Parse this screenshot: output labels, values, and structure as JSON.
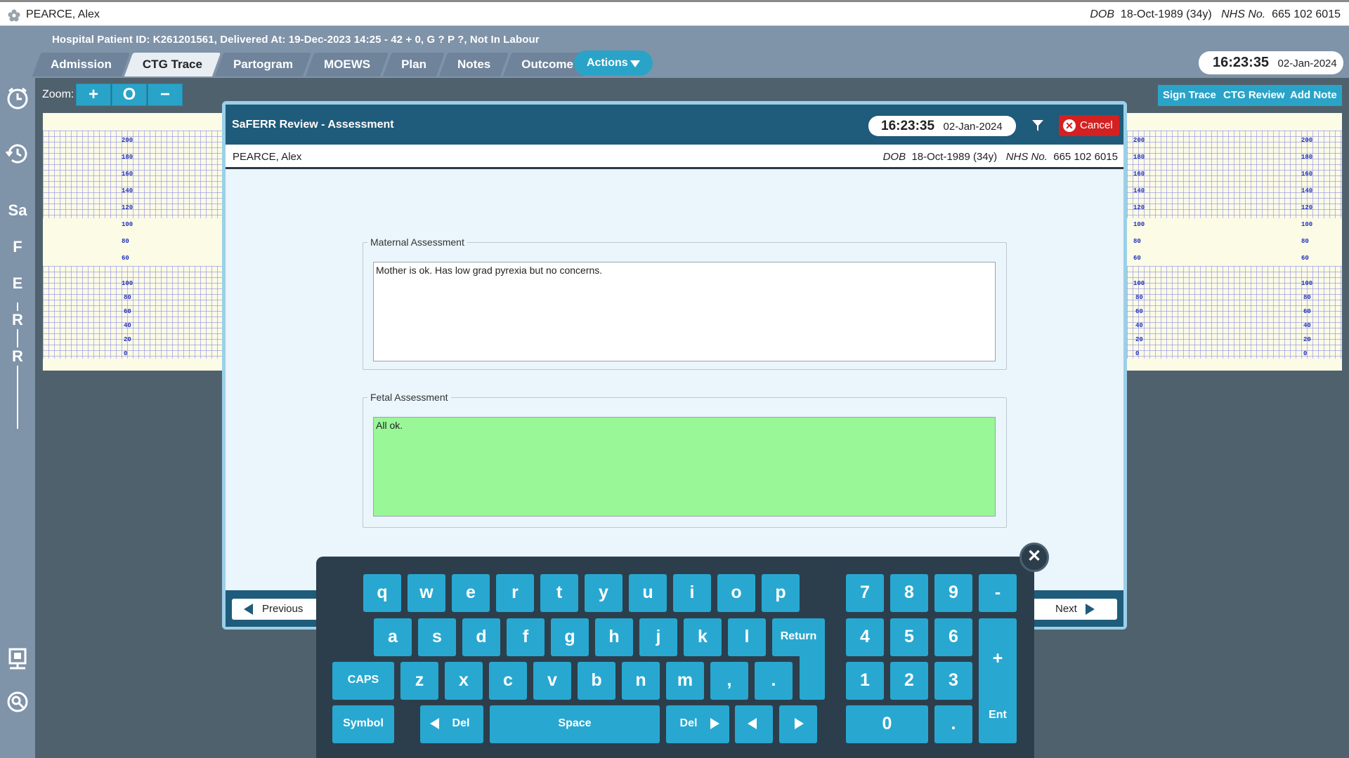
{
  "patient_bar": {
    "name": "PEARCE, Alex",
    "dob_label": "DOB",
    "dob_value": "18-Oct-1989 (34y)",
    "nhs_label": "NHS No.",
    "nhs_value": "665 102 6015"
  },
  "header": {
    "info": "Hospital Patient ID: K261201561, Delivered At: 19-Dec-2023 14:25 - 42 + 0, G ? P ?,   Not In Labour",
    "tabs": [
      {
        "label": "Admission"
      },
      {
        "label": "CTG Trace",
        "active": true
      },
      {
        "label": "Partogram"
      },
      {
        "label": "MOEWS"
      },
      {
        "label": "Plan"
      },
      {
        "label": "Notes"
      },
      {
        "label": "Outcome"
      }
    ],
    "actions_label": "Actions",
    "clock_time": "16:23:35",
    "clock_date": "02-Jan-2024"
  },
  "sidebar": {
    "letters": [
      "Sa",
      "F",
      "E",
      "R",
      "R"
    ]
  },
  "toolbar": {
    "zoom_label": "Zoom:",
    "zoom_in": "+",
    "zoom_reset": "O",
    "zoom_out": "−",
    "sign_trace": "Sign Trace",
    "ctg_review": "CTG Review",
    "add_note": "Add Note"
  },
  "ctg_scale": {
    "fhr": [
      "200",
      "180",
      "160",
      "140",
      "120",
      "100",
      "80",
      "60"
    ],
    "toco": [
      "100",
      "80",
      "60",
      "40",
      "20",
      "0"
    ]
  },
  "modal": {
    "title": "SaFERR Review - Assessment",
    "clock_time": "16:23:35",
    "clock_date": "02-Jan-2024",
    "cancel_label": "Cancel",
    "patient_name": "PEARCE, Alex",
    "dob_label": "DOB",
    "dob_value": "18-Oct-1989 (34y)",
    "nhs_label": "NHS No.",
    "nhs_value": "665 102 6015",
    "maternal_legend": "Maternal Assessment",
    "maternal_text": "Mother is ok. Has low grad pyrexia but no concerns.",
    "fetal_legend": "Fetal Assessment",
    "fetal_text": "All ok.",
    "fetal_bg": "#99f797",
    "previous_label": "Previous",
    "next_label": "Next"
  },
  "keyboard": {
    "row1": [
      "q",
      "w",
      "e",
      "r",
      "t",
      "y",
      "u",
      "i",
      "o",
      "p"
    ],
    "row2": [
      "a",
      "s",
      "d",
      "f",
      "g",
      "h",
      "j",
      "k",
      "l"
    ],
    "row3": [
      "z",
      "x",
      "c",
      "v",
      "b",
      "n",
      "m",
      ",",
      "."
    ],
    "caps": "CAPS",
    "return": "Return",
    "symbol": "Symbol",
    "del_left": "Del",
    "space": "Space",
    "del_right": "Del",
    "num_row1": [
      "7",
      "8",
      "9",
      "-"
    ],
    "num_row2": [
      "4",
      "5",
      "6"
    ],
    "num_row3": [
      "1",
      "2",
      "3"
    ],
    "plus": "+",
    "zero": "0",
    "dot": ".",
    "enter": "Ent",
    "accent": "#28a8d0"
  }
}
